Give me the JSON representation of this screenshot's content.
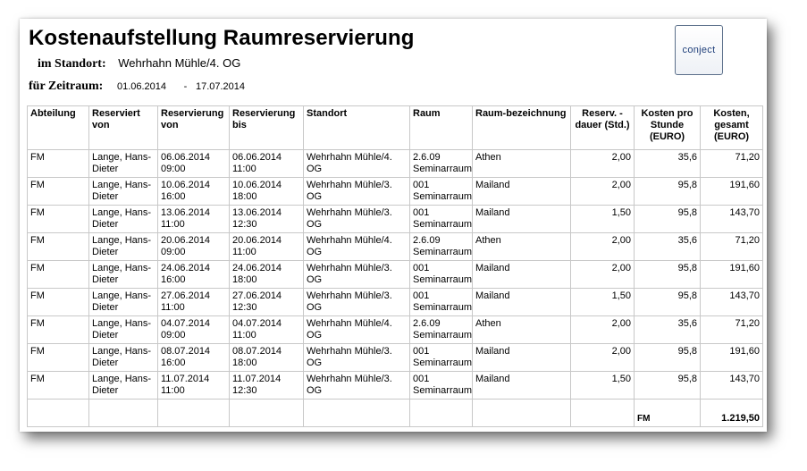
{
  "title": "Kostenaufstellung Raumreservierung",
  "standort_label": "im Standort:",
  "standort_value": "Wehrhahn Mühle/4. OG",
  "zeitraum_label": "für Zeitraum:",
  "zeitraum_from": "01.06.2014",
  "zeitraum_dash": "-",
  "zeitraum_to": "17.07.2014",
  "logo_text": "conject",
  "columns": [
    "Abteilung",
    "Reserviert von",
    "Reservierung von",
    "Reservierung bis",
    "Standort",
    "Raum",
    "Raum-bezeichnung",
    "Reserv. -dauer (Std.)",
    "Kosten pro Stunde (EURO)",
    "Kosten, gesamt (EURO)"
  ],
  "rows": [
    {
      "abteilung": "FM",
      "reserviert": "Lange, Hans-Dieter",
      "von": "06.06.2014 09:00",
      "bis": "06.06.2014 11:00",
      "standort": "Wehrhahn Mühle/4. OG",
      "raum": "2.6.09 Seminarraum",
      "bez": "Athen",
      "dauer": "2,00",
      "kosten_std": "35,6",
      "kosten_ges": "71,20"
    },
    {
      "abteilung": "FM",
      "reserviert": "Lange, Hans-Dieter",
      "von": "10.06.2014 16:00",
      "bis": "10.06.2014 18:00",
      "standort": "Wehrhahn Mühle/3. OG",
      "raum": "001 Seminarraum",
      "bez": "Mailand",
      "dauer": "2,00",
      "kosten_std": "95,8",
      "kosten_ges": "191,60"
    },
    {
      "abteilung": "FM",
      "reserviert": "Lange, Hans-Dieter",
      "von": "13.06.2014 11:00",
      "bis": "13.06.2014 12:30",
      "standort": "Wehrhahn Mühle/3. OG",
      "raum": "001 Seminarraum",
      "bez": "Mailand",
      "dauer": "1,50",
      "kosten_std": "95,8",
      "kosten_ges": "143,70"
    },
    {
      "abteilung": "FM",
      "reserviert": "Lange, Hans-Dieter",
      "von": "20.06.2014 09:00",
      "bis": "20.06.2014 11:00",
      "standort": "Wehrhahn Mühle/4. OG",
      "raum": "2.6.09 Seminarraum",
      "bez": "Athen",
      "dauer": "2,00",
      "kosten_std": "35,6",
      "kosten_ges": "71,20"
    },
    {
      "abteilung": "FM",
      "reserviert": "Lange, Hans-Dieter",
      "von": "24.06.2014 16:00",
      "bis": "24.06.2014 18:00",
      "standort": "Wehrhahn Mühle/3. OG",
      "raum": "001 Seminarraum",
      "bez": "Mailand",
      "dauer": "2,00",
      "kosten_std": "95,8",
      "kosten_ges": "191,60"
    },
    {
      "abteilung": "FM",
      "reserviert": "Lange, Hans-Dieter",
      "von": "27.06.2014 11:00",
      "bis": "27.06.2014 12:30",
      "standort": "Wehrhahn Mühle/3. OG",
      "raum": "001 Seminarraum",
      "bez": "Mailand",
      "dauer": "1,50",
      "kosten_std": "95,8",
      "kosten_ges": "143,70"
    },
    {
      "abteilung": "FM",
      "reserviert": "Lange, Hans-Dieter",
      "von": "04.07.2014 09:00",
      "bis": "04.07.2014 11:00",
      "standort": "Wehrhahn Mühle/4. OG",
      "raum": "2.6.09 Seminarraum",
      "bez": "Athen",
      "dauer": "2,00",
      "kosten_std": "35,6",
      "kosten_ges": "71,20"
    },
    {
      "abteilung": "FM",
      "reserviert": "Lange, Hans-Dieter",
      "von": "08.07.2014 16:00",
      "bis": "08.07.2014 18:00",
      "standort": "Wehrhahn Mühle/3. OG",
      "raum": "001 Seminarraum",
      "bez": "Mailand",
      "dauer": "2,00",
      "kosten_std": "95,8",
      "kosten_ges": "191,60"
    },
    {
      "abteilung": "FM",
      "reserviert": "Lange, Hans-Dieter",
      "von": "11.07.2014 11:00",
      "bis": "11.07.2014 12:30",
      "standort": "Wehrhahn Mühle/3. OG",
      "raum": "001 Seminarraum",
      "bez": "Mailand",
      "dauer": "1,50",
      "kosten_std": "95,8",
      "kosten_ges": "143,70"
    }
  ],
  "total": {
    "label": "FM",
    "value": "1.219,50"
  }
}
